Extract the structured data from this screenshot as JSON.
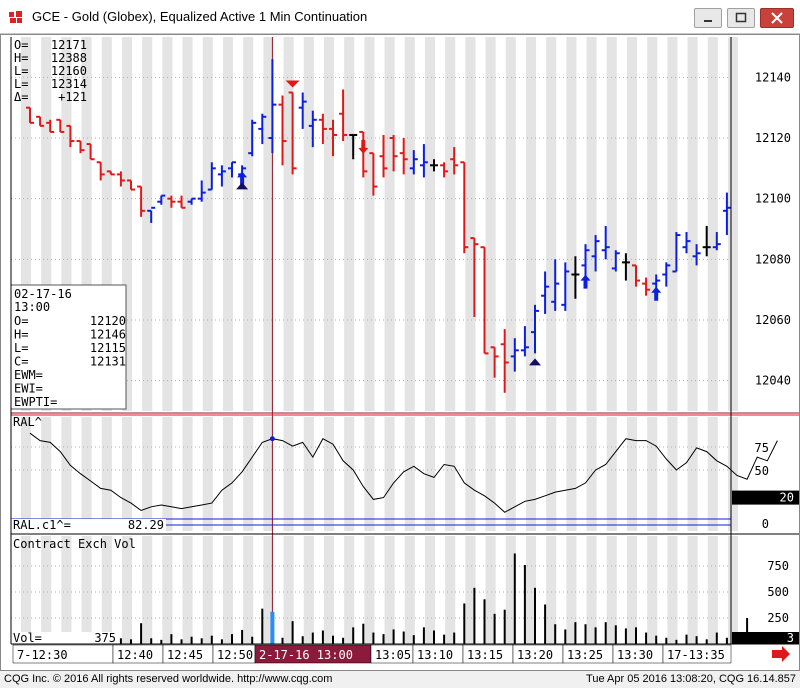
{
  "window": {
    "title": "GCE - Gold (Globex), Equalized Active 1 Min Continuation"
  },
  "ohlc_current": {
    "rows": [
      {
        "label": "O=",
        "value": "12171"
      },
      {
        "label": "H=",
        "value": "12388"
      },
      {
        "label": "L=",
        "value": "12160"
      },
      {
        "label": "L=",
        "value": "12314"
      },
      {
        "label": "Δ=",
        "value": "+121"
      }
    ]
  },
  "cursor_info": {
    "date": "02-17-16",
    "time": "13:00",
    "rows": [
      {
        "label": "O=",
        "value": "12120"
      },
      {
        "label": "H=",
        "value": "12146"
      },
      {
        "label": "L=",
        "value": "12115"
      },
      {
        "label": "C=",
        "value": "12131"
      },
      {
        "label": "EWM=",
        "value": ""
      },
      {
        "label": "EWI=",
        "value": ""
      },
      {
        "label": "EWPTI=",
        "value": ""
      }
    ]
  },
  "price_axis": {
    "ticks": [
      "12140",
      "12120",
      "12100",
      "12080",
      "12060",
      "12040"
    ]
  },
  "ral_panel": {
    "title": "RAL^",
    "readout_label": "RAL.c1^=",
    "readout_value": "82.29",
    "ticks": [
      "75",
      "50",
      "0"
    ],
    "marker_value": "20"
  },
  "vol_panel": {
    "title": "Contract Exch Vol",
    "readout_label": "Vol=",
    "readout_value": "375",
    "ticks": [
      "750",
      "500",
      "250"
    ],
    "marker_value": "3"
  },
  "time_axis": {
    "labels": [
      "7-12:30",
      "12:40",
      "12:45",
      "12:50",
      "2-17-16  13:00",
      "13:05",
      "13:10",
      "13:15",
      "13:20",
      "13:25",
      "13:30",
      "17-13:35"
    ]
  },
  "colors": {
    "up": "#0b1fe0",
    "down": "#e01818",
    "neutral": "#000000",
    "cursor_line": "#8b1a2b",
    "cursor_label_bg": "#8b1a3b",
    "stripe": "#e4e4e4"
  },
  "bars": [
    {
      "o": 12130,
      "h": 12130,
      "l": 12125,
      "c": 12125
    },
    {
      "o": 12127,
      "h": 12127,
      "l": 12124,
      "c": 12124
    },
    {
      "o": 12125,
      "h": 12126,
      "l": 12122,
      "c": 12122
    },
    {
      "o": 12126,
      "h": 12126,
      "l": 12122,
      "c": 12122
    },
    {
      "o": 12124,
      "h": 12124,
      "l": 12117,
      "c": 12119
    },
    {
      "o": 12119,
      "h": 12119,
      "l": 12115,
      "c": 12116
    },
    {
      "o": 12118,
      "h": 12118,
      "l": 12113,
      "c": 12113
    },
    {
      "o": 12112,
      "h": 12112,
      "l": 12106,
      "c": 12108
    },
    {
      "o": 12109,
      "h": 12109,
      "l": 12108,
      "c": 12108
    },
    {
      "o": 12108,
      "h": 12109,
      "l": 12104,
      "c": 12106
    },
    {
      "o": 12106,
      "h": 12106,
      "l": 12103,
      "c": 12103
    },
    {
      "o": 12104,
      "h": 12104,
      "l": 12094,
      "c": 12096
    },
    {
      "o": 12096,
      "h": 12096,
      "l": 12092,
      "c": 12097
    },
    {
      "o": 12099,
      "h": 12101,
      "l": 12098,
      "c": 12101
    },
    {
      "o": 12100,
      "h": 12101,
      "l": 12097,
      "c": 12099
    },
    {
      "o": 12099,
      "h": 12101,
      "l": 12097,
      "c": 12097
    },
    {
      "o": 12099,
      "h": 12100,
      "l": 12098,
      "c": 12100
    },
    {
      "o": 12100,
      "h": 12106,
      "l": 12099,
      "c": 12102
    },
    {
      "o": 12103,
      "h": 12112,
      "l": 12103,
      "c": 12110
    },
    {
      "o": 12108,
      "h": 12111,
      "l": 12104,
      "c": 12109
    },
    {
      "o": 12110,
      "h": 12112,
      "l": 12107,
      "c": 12112
    },
    {
      "o": 12108,
      "h": 12111,
      "l": 12107,
      "c": 12110
    },
    {
      "o": 12115,
      "h": 12126,
      "l": 12114,
      "c": 12125
    },
    {
      "o": 12123,
      "h": 12128,
      "l": 12118,
      "c": 12127
    },
    {
      "o": 12120,
      "h": 12146,
      "l": 12115,
      "c": 12131
    },
    {
      "o": 12131,
      "h": 12134,
      "l": 12111,
      "c": 12119
    },
    {
      "o": 12135,
      "h": 12135,
      "l": 12108,
      "c": 12110
    },
    {
      "o": 12130,
      "h": 12135,
      "l": 12123,
      "c": 12132
    },
    {
      "o": 12124,
      "h": 12129,
      "l": 12117,
      "c": 12126
    },
    {
      "o": 12126,
      "h": 12128,
      "l": 12118,
      "c": 12123
    },
    {
      "o": 12123,
      "h": 12126,
      "l": 12114,
      "c": 12121
    },
    {
      "o": 12128,
      "h": 12136,
      "l": 12119,
      "c": 12121
    },
    {
      "o": 12121,
      "h": 12121,
      "l": 12113,
      "c": 12121
    },
    {
      "o": 12122,
      "h": 12122,
      "l": 12107,
      "c": 12109
    },
    {
      "o": 12115,
      "h": 12115,
      "l": 12101,
      "c": 12104
    },
    {
      "o": 12114,
      "h": 12121,
      "l": 12107,
      "c": 12110
    },
    {
      "o": 12120,
      "h": 12121,
      "l": 12109,
      "c": 12114
    },
    {
      "o": 12115,
      "h": 12120,
      "l": 12108,
      "c": 12113
    },
    {
      "o": 12110,
      "h": 12116,
      "l": 12108,
      "c": 12113
    },
    {
      "o": 12111,
      "h": 12118,
      "l": 12107,
      "c": 12112
    },
    {
      "o": 12111,
      "h": 12113,
      "l": 12109,
      "c": 12111
    },
    {
      "o": 12111,
      "h": 12112,
      "l": 12107,
      "c": 12109
    },
    {
      "o": 12113,
      "h": 12117,
      "l": 12108,
      "c": 12111
    },
    {
      "o": 12112,
      "h": 12112,
      "l": 12082,
      "c": 12084
    },
    {
      "o": 12087,
      "h": 12087,
      "l": 12061,
      "c": 12085
    },
    {
      "o": 12084,
      "h": 12084,
      "l": 12049,
      "c": 12049
    },
    {
      "o": 12051,
      "h": 12051,
      "l": 12041,
      "c": 12048
    },
    {
      "o": 12052,
      "h": 12057,
      "l": 12036,
      "c": 12046
    },
    {
      "o": 12048,
      "h": 12054,
      "l": 12043,
      "c": 12050
    },
    {
      "o": 12050,
      "h": 12058,
      "l": 12048,
      "c": 12051
    },
    {
      "o": 12056,
      "h": 12065,
      "l": 12049,
      "c": 12063
    },
    {
      "o": 12068,
      "h": 12076,
      "l": 12062,
      "c": 12071
    },
    {
      "o": 12066,
      "h": 12080,
      "l": 12063,
      "c": 12072
    },
    {
      "o": 12065,
      "h": 12079,
      "l": 12063,
      "c": 12076
    },
    {
      "o": 12075,
      "h": 12081,
      "l": 12067,
      "c": 12075
    },
    {
      "o": 12078,
      "h": 12085,
      "l": 12073,
      "c": 12083
    },
    {
      "o": 12081,
      "h": 12088,
      "l": 12076,
      "c": 12086
    },
    {
      "o": 12083,
      "h": 12091,
      "l": 12080,
      "c": 12084
    },
    {
      "o": 12077,
      "h": 12083,
      "l": 12076,
      "c": 12082
    },
    {
      "o": 12079,
      "h": 12082,
      "l": 12073,
      "c": 12079
    },
    {
      "o": 12078,
      "h": 12078,
      "l": 12071,
      "c": 12073
    },
    {
      "o": 12072,
      "h": 12074,
      "l": 12068,
      "c": 12070
    },
    {
      "o": 12072,
      "h": 12075,
      "l": 12069,
      "c": 12073
    },
    {
      "o": 12075,
      "h": 12079,
      "l": 12071,
      "c": 12078
    },
    {
      "o": 12076,
      "h": 12089,
      "l": 12076,
      "c": 12088
    },
    {
      "o": 12084,
      "h": 12089,
      "l": 12082,
      "c": 12086
    },
    {
      "o": 12081,
      "h": 12085,
      "l": 12078,
      "c": 12082
    },
    {
      "o": 12084,
      "h": 12091,
      "l": 12081,
      "c": 12084
    },
    {
      "o": 12084,
      "h": 12089,
      "l": 12083,
      "c": 12085
    },
    {
      "o": 12096,
      "h": 12102,
      "l": 12088,
      "c": 12097
    }
  ],
  "ral": [
    90,
    82,
    80,
    70,
    55,
    46,
    38,
    30,
    28,
    20,
    14,
    6,
    10,
    12,
    10,
    8,
    10,
    12,
    14,
    28,
    36,
    48,
    64,
    80,
    84,
    82,
    76,
    80,
    64,
    84,
    78,
    60,
    50,
    32,
    18,
    20,
    36,
    48,
    54,
    46,
    42,
    56,
    54,
    36,
    28,
    22,
    14,
    4,
    10,
    16,
    18,
    22,
    26,
    28,
    30,
    36,
    50,
    56,
    70,
    84,
    82,
    82,
    76,
    62,
    50,
    58,
    74,
    70,
    60,
    54,
    44,
    40,
    64,
    60,
    82
  ],
  "volume": [
    60,
    100,
    80,
    65,
    30,
    55,
    75,
    40,
    25,
    55,
    45,
    200,
    55,
    40,
    95,
    45,
    70,
    55,
    80,
    45,
    95,
    135,
    70,
    340,
    310,
    60,
    220,
    75,
    110,
    130,
    80,
    60,
    160,
    195,
    110,
    95,
    140,
    120,
    85,
    160,
    130,
    90,
    110,
    390,
    540,
    430,
    290,
    330,
    870,
    760,
    540,
    380,
    190,
    140,
    210,
    190,
    160,
    210,
    180,
    150,
    160,
    110,
    80,
    60,
    40,
    90,
    75,
    45,
    110,
    60,
    80,
    250
  ]
}
